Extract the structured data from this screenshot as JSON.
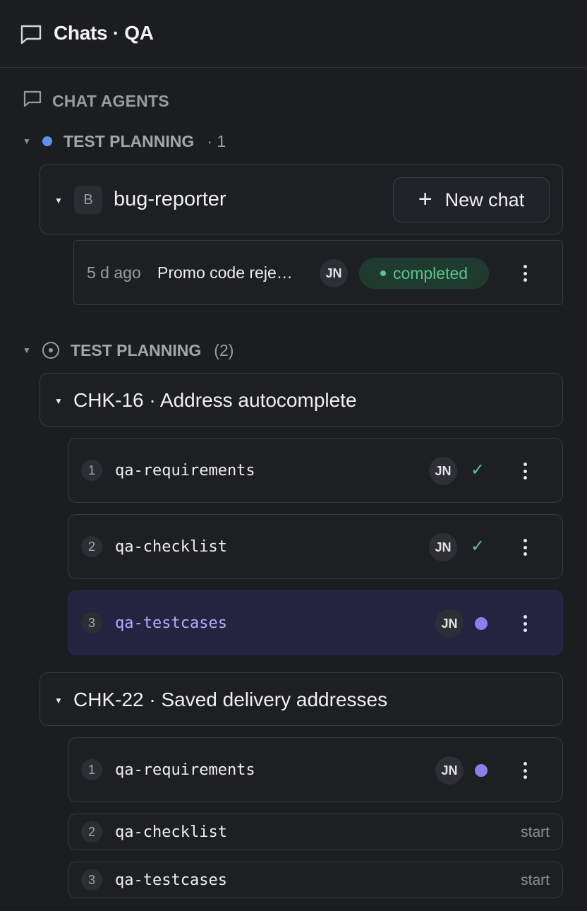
{
  "header": {
    "title": "Chats · QA",
    "icon": "chat-bubble-icon"
  },
  "section": {
    "label": "CHAT AGENTS",
    "icon": "chat-bubble-icon"
  },
  "group1": {
    "label": "TEST PLANNING",
    "count": "· 1",
    "dot_color": "#5b93ea",
    "agent": {
      "badge": "B",
      "name": "bug-reporter",
      "new_chat_label": "New chat",
      "chats": [
        {
          "time": "5 d ago",
          "title": "Promo code reje…",
          "avatar": "JN",
          "status": "completed"
        }
      ]
    }
  },
  "group2": {
    "label": "TEST PLANNING",
    "count": "(2)",
    "tickets": [
      {
        "title": "CHK-16 · Address autocomplete",
        "steps": [
          {
            "num": "1",
            "name": "qa-requirements",
            "avatar": "JN",
            "state": "done"
          },
          {
            "num": "2",
            "name": "qa-checklist",
            "avatar": "JN",
            "state": "done"
          },
          {
            "num": "3",
            "name": "qa-testcases",
            "avatar": "JN",
            "state": "in-progress"
          }
        ]
      },
      {
        "title": "CHK-22 · Saved delivery addresses",
        "steps": [
          {
            "num": "1",
            "name": "qa-requirements",
            "avatar": "JN",
            "state": "in-progress"
          },
          {
            "num": "2",
            "name": "qa-checklist",
            "action": "start"
          },
          {
            "num": "3",
            "name": "qa-testcases",
            "action": "start"
          }
        ]
      }
    ]
  },
  "colors": {
    "accent_purple": "#8b7ff0",
    "success_green": "#5bc48a",
    "active_row_bg": "#252340"
  }
}
